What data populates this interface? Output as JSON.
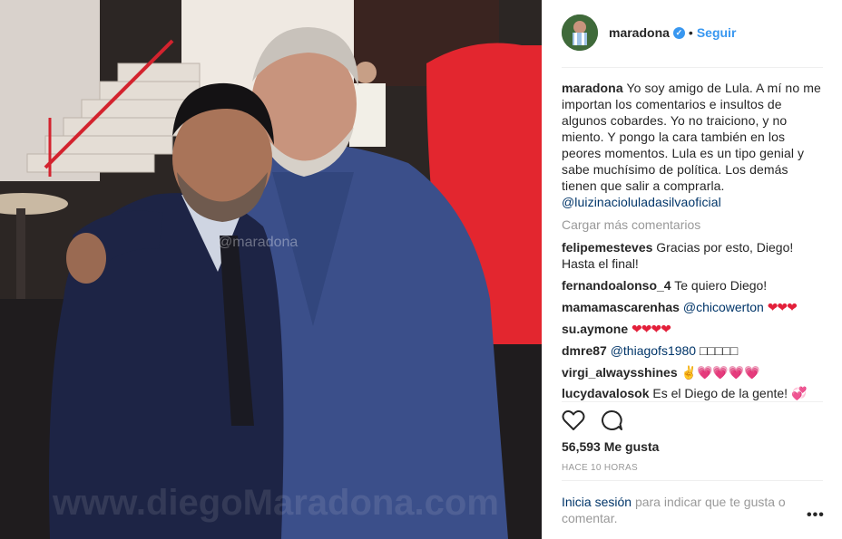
{
  "post": {
    "username": "maradona",
    "follow_label": "Seguir",
    "separator": "•",
    "verified_glyph": "✓",
    "watermark_small": "@maradona",
    "watermark_big": "www.diegoMaradona.com"
  },
  "caption": {
    "username": "maradona",
    "text": "Yo soy amigo de Lula. A mí no me importan los comentarios e insultos de algunos cobardes. Yo no traiciono, y no miento. Y pongo la cara también en los peores momentos. Lula es un tipo genial y sabe muchísimo de política. Los demás tienen que salir a comprarla.",
    "mention": "@luizinacioluladasilvaoficial"
  },
  "load_more": "Cargar más comentarios",
  "comments": [
    {
      "user": "felipemesteves",
      "text": "Gracias por esto, Diego! Hasta el final!"
    },
    {
      "user": "fernandoalonso_4",
      "text": "Te quiero Diego!"
    },
    {
      "user": "mamamascarenhas",
      "mention": "@chicowerton",
      "emoji": "❤❤❤"
    },
    {
      "user": "su.aymone",
      "emoji": "❤❤❤❤"
    },
    {
      "user": "dmre87",
      "mention": "@thiagofs1980",
      "text": "□□□□□"
    },
    {
      "user": "virgi_alwaysshines",
      "emoji": "✌💗💗💗💗"
    },
    {
      "user": "lucydavalosok",
      "text": "Es el Diego de la gente!",
      "emoji": "💞"
    }
  ],
  "icons": {
    "like": "heart-outline-icon",
    "comment": "comment-bubble-icon",
    "options": "more-options-icon"
  },
  "likes": "56,593 Me gusta",
  "time": "HACE 10 HORAS",
  "login": {
    "link": "Inicia sesión",
    "rest": "para indicar que te gusta o comentar."
  },
  "options_glyph": "•••",
  "colors": {
    "accent": "#3897f0",
    "link": "#003569",
    "muted": "#999999",
    "heart": "#e3203a"
  }
}
